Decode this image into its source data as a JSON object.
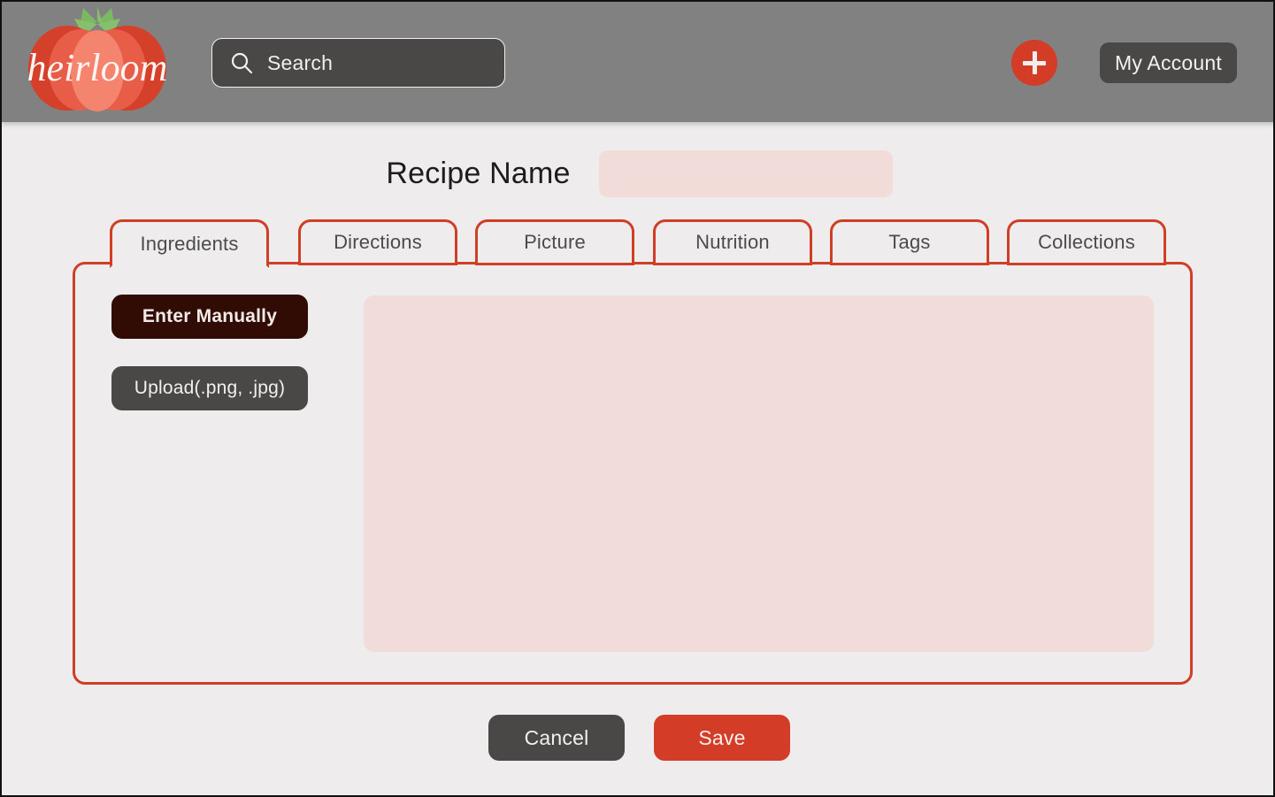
{
  "colors": {
    "header_bg": "#818181",
    "page_bg": "#eeeced",
    "accent_red": "#d33c26",
    "tab_border": "#cf3f26",
    "dark_button": "#4a4846",
    "active_dark": "#300c05",
    "pink_field": "#f2dcd9",
    "leaf_green": "#7cb763"
  },
  "header": {
    "logo": {
      "name": "heirloom",
      "icon": "tomato-logo"
    },
    "search": {
      "icon": "search-icon",
      "placeholder": "Search",
      "value": ""
    },
    "add_button": {
      "icon": "plus-icon",
      "label": "+"
    },
    "account_button": {
      "label": "My Account"
    }
  },
  "form": {
    "recipe_name": {
      "label": "Recipe Name",
      "placeholder": "",
      "value": ""
    },
    "tabs": [
      {
        "label": "Ingredients",
        "active": true
      },
      {
        "label": "Directions",
        "active": false
      },
      {
        "label": "Picture",
        "active": false
      },
      {
        "label": "Nutrition",
        "active": false
      },
      {
        "label": "Tags",
        "active": false
      },
      {
        "label": "Collections",
        "active": false
      }
    ],
    "ingredients_panel": {
      "enter_manually_label": "Enter Manually",
      "upload_label": "Upload",
      "upload_extensions": " (.png, .jpg)",
      "textarea": {
        "placeholder": "",
        "value": ""
      }
    }
  },
  "footer": {
    "cancel_label": "Cancel",
    "save_label": "Save"
  }
}
